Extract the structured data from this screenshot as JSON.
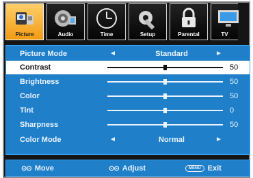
{
  "tabs": [
    {
      "label": "Picture",
      "icon": "picture-icon",
      "active": true
    },
    {
      "label": "Audio",
      "icon": "audio-icon",
      "active": false
    },
    {
      "label": "Time",
      "icon": "clock-icon",
      "active": false
    },
    {
      "label": "Setup",
      "icon": "wrench-icon",
      "active": false
    },
    {
      "label": "Parental",
      "icon": "lock-icon",
      "active": false
    },
    {
      "label": "TV",
      "icon": "tv-icon",
      "active": false
    }
  ],
  "rows": {
    "picture_mode": {
      "label": "Picture Mode",
      "value": "Standard",
      "left_arrow": "◄",
      "right_arrow": "►"
    },
    "contrast": {
      "label": "Contrast",
      "value": "50",
      "level": 50
    },
    "brightness": {
      "label": "Brightness",
      "value": "50",
      "level": 50
    },
    "color": {
      "label": "Color",
      "value": "50",
      "level": 50
    },
    "tint": {
      "label": "Tint",
      "value": "0",
      "level": 50
    },
    "sharpness": {
      "label": "Sharpness",
      "value": "50",
      "level": 50
    },
    "color_mode": {
      "label": "Color Mode",
      "value": "Normal",
      "left_arrow": "◄",
      "right_arrow": "►"
    }
  },
  "footer": {
    "move_symbol": "⊙⊙",
    "move_label": "Move",
    "adjust_symbol": "⊙⊙",
    "adjust_label": "Adjust",
    "menu_key": "MENU",
    "exit_label": "Exit"
  },
  "colors": {
    "panel": "#1f7fc9",
    "active_tab": "#f29b12",
    "selected_row": "#ffffff"
  }
}
